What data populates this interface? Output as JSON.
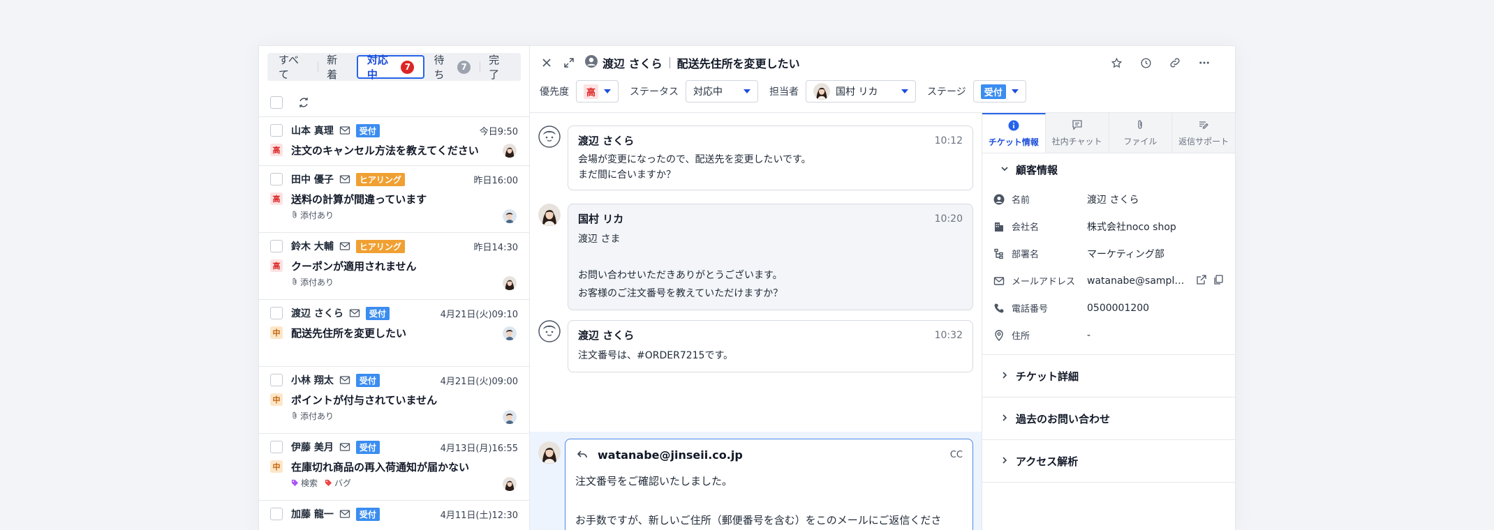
{
  "tabs": [
    {
      "label": "すべて",
      "count": null
    },
    {
      "label": "新着",
      "count": null
    },
    {
      "label": "対応中",
      "count": "7",
      "active": true
    },
    {
      "label": "待ち",
      "count": "7"
    },
    {
      "label": "完了",
      "count": null
    }
  ],
  "tickets": [
    {
      "name": "山本 真理",
      "status": "受付",
      "status_color": "blue",
      "time": "今日9:50",
      "priority": "高",
      "priority_level": "high",
      "subject": "注文のキャンセル方法を教えてください",
      "tags": []
    },
    {
      "name": "田中 優子",
      "status": "ヒアリング",
      "status_color": "orange",
      "time": "昨日16:00",
      "priority": "高",
      "priority_level": "high",
      "subject": "送料の計算が間違っています",
      "tags": [
        "添付あり"
      ]
    },
    {
      "name": "鈴木 大輔",
      "status": "ヒアリング",
      "status_color": "orange",
      "time": "昨日14:30",
      "priority": "高",
      "priority_level": "high",
      "subject": "クーポンが適用されません",
      "tags": [
        "添付あり"
      ]
    },
    {
      "name": "渡辺 さくら",
      "status": "受付",
      "status_color": "blue",
      "time": "4月21日(火)09:10",
      "priority": "中",
      "priority_level": "mid",
      "subject": "配送先住所を変更したい",
      "tags": []
    },
    {
      "name": "小林 翔太",
      "status": "受付",
      "status_color": "blue",
      "time": "4月21日(火)09:00",
      "priority": "中",
      "priority_level": "mid",
      "subject": "ポイントが付与されていません",
      "tags": [
        "添付あり"
      ]
    },
    {
      "name": "伊藤 美月",
      "status": "受付",
      "status_color": "blue",
      "time": "4月13日(月)16:55",
      "priority": "中",
      "priority_level": "mid",
      "subject": "在庫切れ商品の再入荷通知が届かない",
      "tags": [
        "検索",
        "バグ"
      ]
    },
    {
      "name": "加藤 龍一",
      "status": "受付",
      "status_color": "blue",
      "time": "4月11日(土)12:30",
      "priority": "",
      "priority_level": "",
      "subject": "",
      "tags": []
    }
  ],
  "header": {
    "customer": "渡辺 さくら",
    "subject": "配送先住所を変更したい",
    "priority_label": "優先度",
    "priority_value": "高",
    "status_label": "ステータス",
    "status_value": "対応中",
    "assignee_label": "担当者",
    "assignee_value": "国村 リカ",
    "stage_label": "ステージ",
    "stage_value": "受付"
  },
  "messages": [
    {
      "name": "渡辺 さくら",
      "time": "10:12",
      "text": "会場が変更になったので、配送先を変更したいです。\nまだ間に合いますか？",
      "role": "customer"
    },
    {
      "name": "国村 リカ",
      "time": "10:20",
      "text": "渡辺 さま\n\nお問い合わせいただきありがとうございます。\nお客様のご注文番号を教えていただけますか？",
      "role": "agent"
    },
    {
      "name": "渡辺 さくら",
      "time": "10:32",
      "text": "注文番号は、#ORDER7215です。",
      "role": "customer"
    }
  ],
  "reply": {
    "to": "watanabe@jinseii.co.jp",
    "cc": "CC",
    "text": "注文番号をご確認いたしました。\n\nお手数ですが、新しいご住所（郵便番号を含む）をこのメールにご返信くださ"
  },
  "side_tabs": [
    {
      "label": "チケット情報",
      "icon": "info-icon",
      "active": true
    },
    {
      "label": "社内チャット",
      "icon": "chat-icon"
    },
    {
      "label": "ファイル",
      "icon": "paperclip-icon"
    },
    {
      "label": "返信サポート",
      "icon": "reply-support-icon"
    }
  ],
  "customer_info": {
    "title": "顧客情報",
    "rows": [
      {
        "label": "名前",
        "value": "渡辺 さくら",
        "icon": "person-icon"
      },
      {
        "label": "会社名",
        "value": "株式会社noco shop",
        "icon": "building-icon"
      },
      {
        "label": "部署名",
        "value": "マーケティング部",
        "icon": "org-icon"
      },
      {
        "label": "メールアドレス",
        "value": "watanabe@sampl…",
        "icon": "mail-icon"
      },
      {
        "label": "電話番号",
        "value": "0500001200",
        "icon": "phone-icon"
      },
      {
        "label": "住所",
        "value": "-",
        "icon": "pin-icon"
      }
    ]
  },
  "sections": [
    "チケット詳細",
    "過去のお問い合わせ",
    "アクセス解析"
  ],
  "colors": {
    "accent": "#2563eb",
    "high": "#dc2626",
    "badge_blue": "#3b8df0",
    "badge_orange": "#f0a032"
  }
}
